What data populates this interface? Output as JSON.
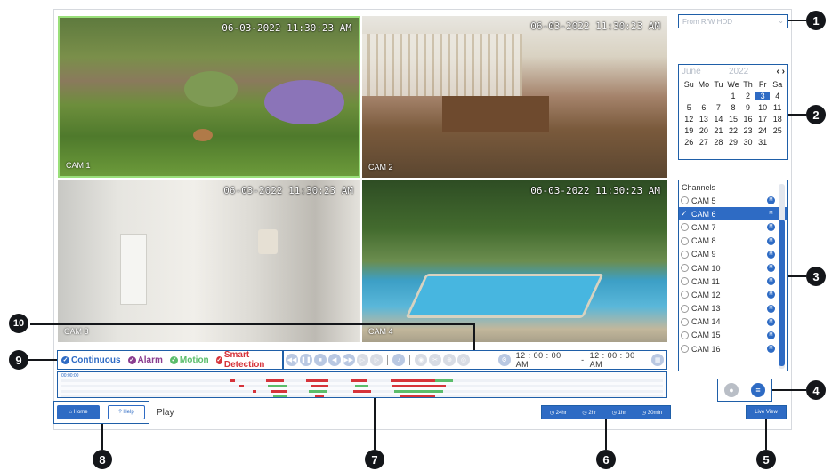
{
  "cameras": [
    {
      "label": "CAM 1",
      "timestamp": "06-03-2022 11:30:23 AM"
    },
    {
      "label": "CAM 2",
      "timestamp": "06-03-2022 11:30:23 AM"
    },
    {
      "label": "CAM 3",
      "timestamp": "06-03-2022 11:30:23 AM"
    },
    {
      "label": "CAM 4",
      "timestamp": "06-03-2022 11:30:23 AM"
    }
  ],
  "legend": {
    "continuous": "Continuous",
    "alarm": "Alarm",
    "motion": "Motion",
    "smart": "Smart Detection",
    "colors": {
      "continuous": "#2e6bc4",
      "alarm": "#8a3d8f",
      "motion": "#5bbd6b",
      "smart": "#d6333a"
    }
  },
  "playback": {
    "time_start": "12 : 00 : 00 AM",
    "time_sep": "-",
    "time_end": "12 : 00 : 00 AM"
  },
  "timeline": {
    "start_label": "00:00:00"
  },
  "footer": {
    "home": "Home",
    "help": "Help",
    "mode": "Play"
  },
  "zoom": [
    "24hr",
    "2hr",
    "1hr",
    "30min"
  ],
  "source": {
    "value": "From R/W HDD"
  },
  "calendar": {
    "month": "June",
    "year": "2022",
    "weekdays": [
      "Su",
      "Mo",
      "Tu",
      "We",
      "Th",
      "Fr",
      "Sa"
    ],
    "days": [
      "",
      "",
      "",
      "1",
      "2",
      "3",
      "4",
      "5",
      "6",
      "7",
      "8",
      "9",
      "10",
      "11",
      "12",
      "13",
      "14",
      "15",
      "16",
      "17",
      "18",
      "19",
      "20",
      "21",
      "22",
      "23",
      "24",
      "25",
      "26",
      "27",
      "28",
      "29",
      "30",
      "31"
    ],
    "selected": "3",
    "underlined": "2"
  },
  "channels": {
    "title": "Channels",
    "items": [
      "CAM 5",
      "CAM 6",
      "CAM 7",
      "CAM 8",
      "CAM 9",
      "CAM 10",
      "CAM 11",
      "CAM 12",
      "CAM 13",
      "CAM 14",
      "CAM 15",
      "CAM 16"
    ],
    "selected": "CAM 6",
    "badge": "M"
  },
  "live_view": "Live View",
  "callouts": [
    "1",
    "2",
    "3",
    "4",
    "5",
    "6",
    "7",
    "8",
    "9",
    "10"
  ]
}
